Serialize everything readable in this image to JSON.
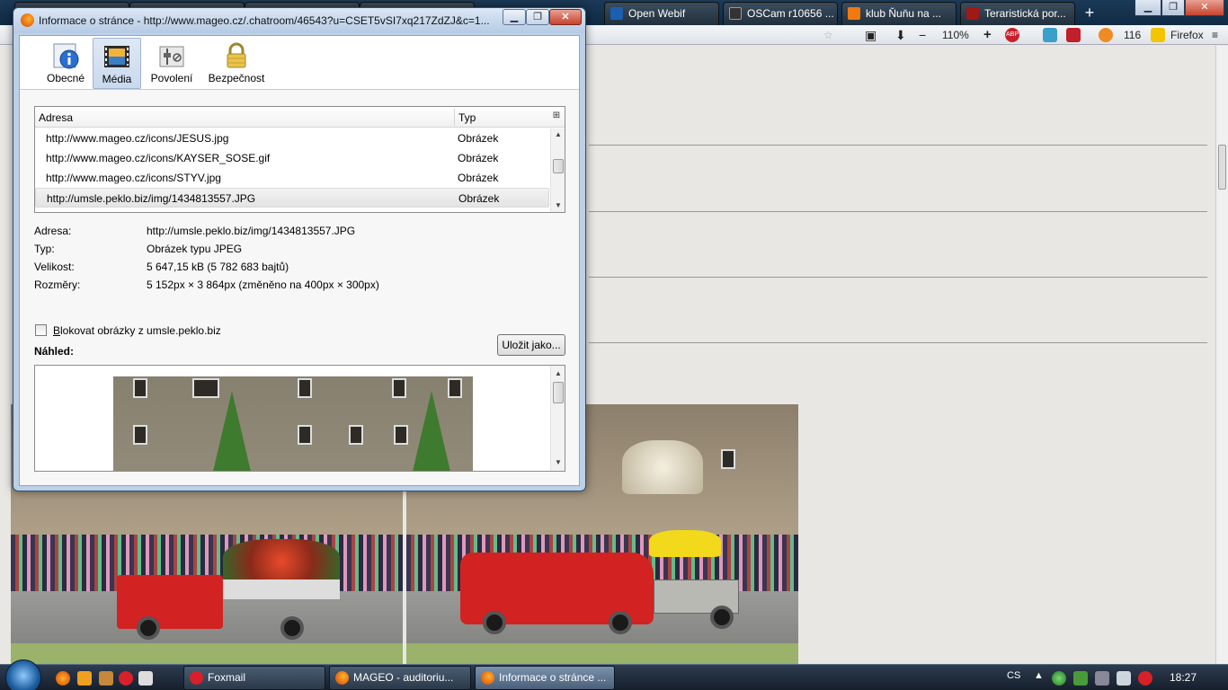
{
  "browser": {
    "tabs": [
      {
        "label": "",
        "icon": "firefox-icon"
      },
      {
        "label": "",
        "icon": "page-icon"
      },
      {
        "label": "",
        "icon": "page-icon"
      },
      {
        "label": "",
        "icon": "page-icon"
      },
      {
        "label": "Open Webif",
        "icon": "openwebif-icon"
      },
      {
        "label": "OSCam r10656 ...",
        "icon": "oscam-icon"
      },
      {
        "label": "klub Ňuňu na ...",
        "icon": "klub-icon"
      },
      {
        "label": "Teraristická por...",
        "icon": "terarium-icon"
      }
    ],
    "new_tab": "+",
    "win_min": "▁",
    "win_max": "❐",
    "win_close": "✕",
    "zoom": "110%",
    "zoom_plus": "+",
    "zoom_minus": "−",
    "abp_label": "ABP",
    "rss_count": "116",
    "app_label": "Firefox"
  },
  "dialog": {
    "title": "Informace o stránce - http://www.mageo.cz/.chatroom/46543?u=CSET5vSI7xq217ZdZJ&c=1...",
    "btn_min": "▁",
    "btn_max": "❐",
    "btn_close": "✕",
    "tabs": [
      {
        "label": "Obecné",
        "icon": "info-icon"
      },
      {
        "label": "Média",
        "icon": "media-icon"
      },
      {
        "label": "Povolení",
        "icon": "permissions-icon"
      },
      {
        "label": "Bezpečnost",
        "icon": "lock-icon"
      }
    ],
    "selected_tab": "Média",
    "list": {
      "columns": [
        "Adresa",
        "Typ"
      ],
      "rows": [
        {
          "address": "http://www.mageo.cz/icons/JESUS.jpg",
          "type": "Obrázek"
        },
        {
          "address": "http://www.mageo.cz/icons/KAYSER_SOSE.gif",
          "type": "Obrázek"
        },
        {
          "address": "http://www.mageo.cz/icons/STYV.jpg",
          "type": "Obrázek"
        },
        {
          "address": "http://umsle.peklo.biz/img/1434813557.JPG",
          "type": "Obrázek"
        }
      ],
      "selected_index": 3
    },
    "details": {
      "address_label": "Adresa:",
      "address_value": "http://umsle.peklo.biz/img/1434813557.JPG",
      "type_label": "Typ:",
      "type_value": "Obrázek typu JPEG",
      "size_label": "Velikost:",
      "size_value": "5 647,15 kB (5 782 683 bajtů)",
      "dims_label": "Rozměry:",
      "dims_value": "5 152px × 3 864px (změněno na 400px × 300px)"
    },
    "block_checkbox_prefix": "B",
    "block_checkbox_rest": "lokovat obrázky z umsle.peklo.biz",
    "block_checked": false,
    "preview_label": "Náhled:",
    "save_button": "Uložit jako..."
  },
  "taskbar": {
    "tasks": [
      {
        "label": "Foxmail",
        "icon": "foxmail-icon"
      },
      {
        "label": "MAGEO - auditoriu...",
        "icon": "firefox-icon"
      },
      {
        "label": "Informace o stránce ...",
        "icon": "firefox-icon"
      }
    ],
    "active_index": 2,
    "language": "CS",
    "time": "18:27"
  }
}
